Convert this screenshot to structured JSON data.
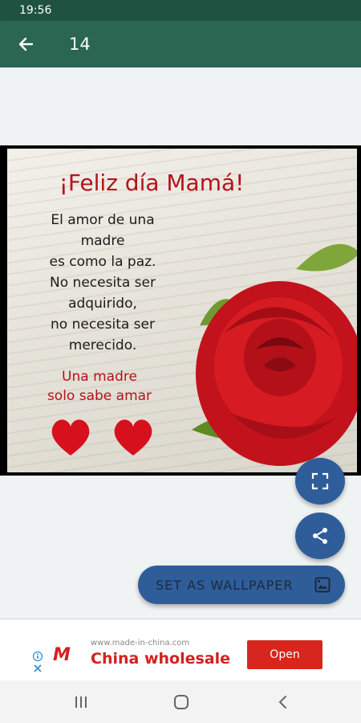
{
  "status_bar": {
    "time": "19:56"
  },
  "app_bar": {
    "title": "14",
    "back_icon": "arrow-left-icon"
  },
  "wallpaper_image": {
    "title": "¡Feliz día Mamá!",
    "body_lines": [
      "El amor de una",
      "madre",
      "es como la paz.",
      "No necesita ser",
      "adquirido,",
      "no necesita ser",
      "merecido."
    ],
    "highlight_lines": [
      "Una madre",
      "solo sabe amar"
    ]
  },
  "actions": {
    "fullscreen_icon": "fullscreen-icon",
    "share_icon": "share-icon",
    "set_wallpaper_label": "SET AS WALLPAPER",
    "wallpaper_icon": "wallpaper-icon"
  },
  "ad": {
    "logo": "M",
    "url": "www.made-in-china.com",
    "headline": "China wholesale",
    "cta": "Open"
  },
  "nav": {
    "recents": "recents-icon",
    "home": "home-icon",
    "back": "back-icon"
  },
  "colors": {
    "app_bar": "#2a6651",
    "status_bar": "#1f5240",
    "fab": "#2f5d9a",
    "ad_red": "#d7261e",
    "title_red": "#b5121b"
  }
}
